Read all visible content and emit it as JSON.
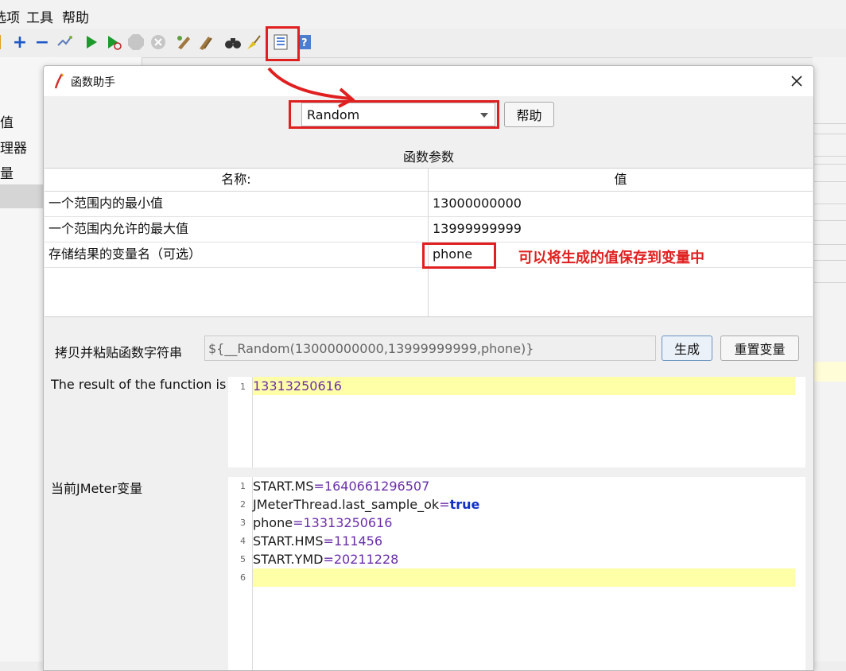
{
  "menubar": {
    "items": [
      "选项",
      "工具",
      "帮助"
    ]
  },
  "tree": {
    "items": [
      "值",
      "理器",
      "量"
    ]
  },
  "dialog": {
    "title": "函数助手",
    "function_select": {
      "value": "Random"
    },
    "help_label": "帮助",
    "params_title": "函数参数",
    "table": {
      "headers": [
        "名称:",
        "值"
      ],
      "rows": [
        {
          "name": "一个范围内的最小值",
          "value": "13000000000"
        },
        {
          "name": "一个范围内允许的最大值",
          "value": "13999999999"
        },
        {
          "name": "存储结果的变量名（可选）",
          "value": "phone"
        }
      ]
    },
    "annotation": "可以将生成的值保存到变量中",
    "copy": {
      "label": "拷贝并粘贴函数字符串",
      "value": "${__Random(13000000000,13999999999,phone)}"
    },
    "generate_label": "生成",
    "reset_label": "重置变量",
    "result": {
      "label": "The result of the function is",
      "lines": [
        "13313250616"
      ]
    },
    "vars": {
      "label": "当前JMeter变量",
      "lines": [
        {
          "key": "START.MS",
          "value": "1640661296507"
        },
        {
          "key": "JMeterThread.last_sample_ok",
          "value": "true"
        },
        {
          "key": "phone",
          "value": "13313250616"
        },
        {
          "key": "START.HMS",
          "value": "111456"
        },
        {
          "key": "START.YMD",
          "value": "20211228"
        },
        {
          "key": "",
          "value": ""
        }
      ]
    }
  },
  "colors": {
    "highlight": "#e02020",
    "editor_current_line": "#ffffa8",
    "value_purple": "#6a2ea8",
    "keyword_blue": "#1030c8"
  }
}
